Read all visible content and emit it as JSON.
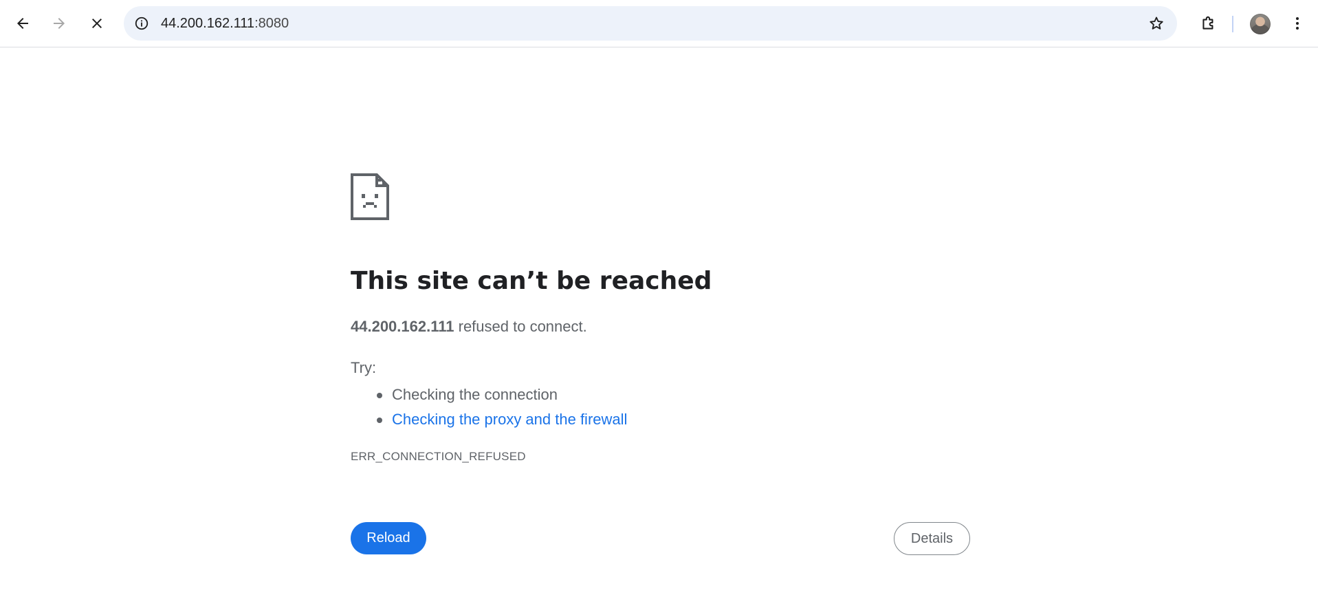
{
  "browser": {
    "back_icon": "back-arrow-icon",
    "forward_icon": "forward-arrow-icon",
    "stop_icon": "close-icon",
    "site_info_icon": "info-icon",
    "address": {
      "host": "44.200.162.111",
      "port": ":8080"
    },
    "bookmark_icon": "star-icon",
    "extensions_icon": "puzzle-piece-icon",
    "menu_icon": "three-dot-menu-icon"
  },
  "error_page": {
    "icon": "sad-document-icon",
    "title": "This site can’t be reached",
    "summary_host": "44.200.162.111",
    "summary_text": " refused to connect.",
    "try_label": "Try:",
    "suggestions": [
      {
        "text": "Checking the connection",
        "is_link": false
      },
      {
        "text": "Checking the proxy and the firewall",
        "is_link": true
      }
    ],
    "error_code": "ERR_CONNECTION_REFUSED",
    "reload_label": "Reload",
    "details_label": "Details"
  },
  "colors": {
    "accent": "#1a73e8",
    "text_secondary": "#5f6368",
    "title": "#202124",
    "omnibox_bg": "#edf2fa"
  }
}
